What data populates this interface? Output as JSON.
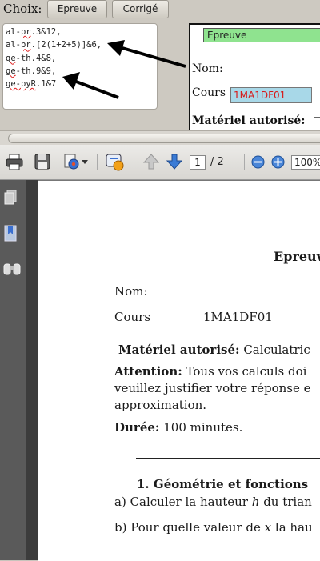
{
  "form": {
    "choix_label": "Choix:",
    "btn_epreuve": "Epreuve",
    "btn_corrige": "Corrigé",
    "code_lines": [
      {
        "pre": "al-",
        "sq": "pr",
        "post": ".3&12,"
      },
      {
        "pre": "al-",
        "sq": "pr",
        "post": ".[2(1+2+5)]&6,"
      },
      {
        "pre": "",
        "sq": "ge",
        "post": "-th.4&8,"
      },
      {
        "pre": "",
        "sq": "ge",
        "post": "-th.9&9,"
      },
      {
        "pre": "",
        "sq": "ge-pyR",
        "post": ".1&7"
      }
    ]
  },
  "preview": {
    "type_field": "Epreuve",
    "nom_label": "Nom:",
    "cours_label": "Cours",
    "cours_value": "1MA1DF01",
    "materiel_label": "Matériel autorisé:"
  },
  "pdf_toolbar": {
    "page_current": "1",
    "page_total": "/ 2",
    "zoom": "100%"
  },
  "document": {
    "title": "Epreuv",
    "nom_label": "Nom:",
    "cours_label": "Cours",
    "cours_value": "1MA1DF01",
    "materiel_label": "Matériel autorisé:",
    "materiel_value": "Calculatric",
    "attention_label": "Attention:",
    "attention_text": "Tous vos calculs doi",
    "attention_line2": "veuillez justifier votre réponse e",
    "attention_line3": "approximation.",
    "duree_label": "Durée:",
    "duree_value": "100 minutes.",
    "section_title": "1.  Géométrie et fonctions",
    "qa_prefix": "a) Calculer la hauteur",
    "qa_var": "h",
    "qa_suffix": "du trian",
    "qb_prefix": "b) Pour quelle valeur de",
    "qb_var": "x",
    "qb_suffix": "la hau"
  }
}
